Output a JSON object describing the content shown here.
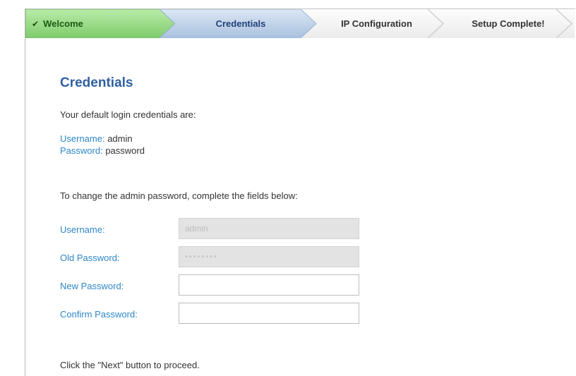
{
  "wizard": {
    "steps": [
      {
        "label": "Welcome",
        "state": "completed",
        "check_icon": "check-icon"
      },
      {
        "label": "Credentials",
        "state": "active"
      },
      {
        "label": "IP Configuration",
        "state": "upcoming"
      },
      {
        "label": "Setup Complete!",
        "state": "upcoming"
      }
    ],
    "colors": {
      "completed": "#8fd37d",
      "active": "#b7cde6",
      "upcoming": "#efefef"
    }
  },
  "page": {
    "title": "Credentials",
    "intro": "Your default login credentials are:",
    "default_username_label": "Username:",
    "default_username_value": "admin",
    "default_password_label": "Password:",
    "default_password_value": "password",
    "change_instruction": "To change the admin password, complete the fields below:",
    "footer_note": "Click the \"Next\" button to proceed."
  },
  "form": {
    "username_label": "Username:",
    "username_value": "admin",
    "old_password_label": "Old Password:",
    "old_password_value": "••••••••",
    "new_password_label": "New Password:",
    "new_password_value": "",
    "confirm_password_label": "Confirm Password:",
    "confirm_password_value": ""
  }
}
